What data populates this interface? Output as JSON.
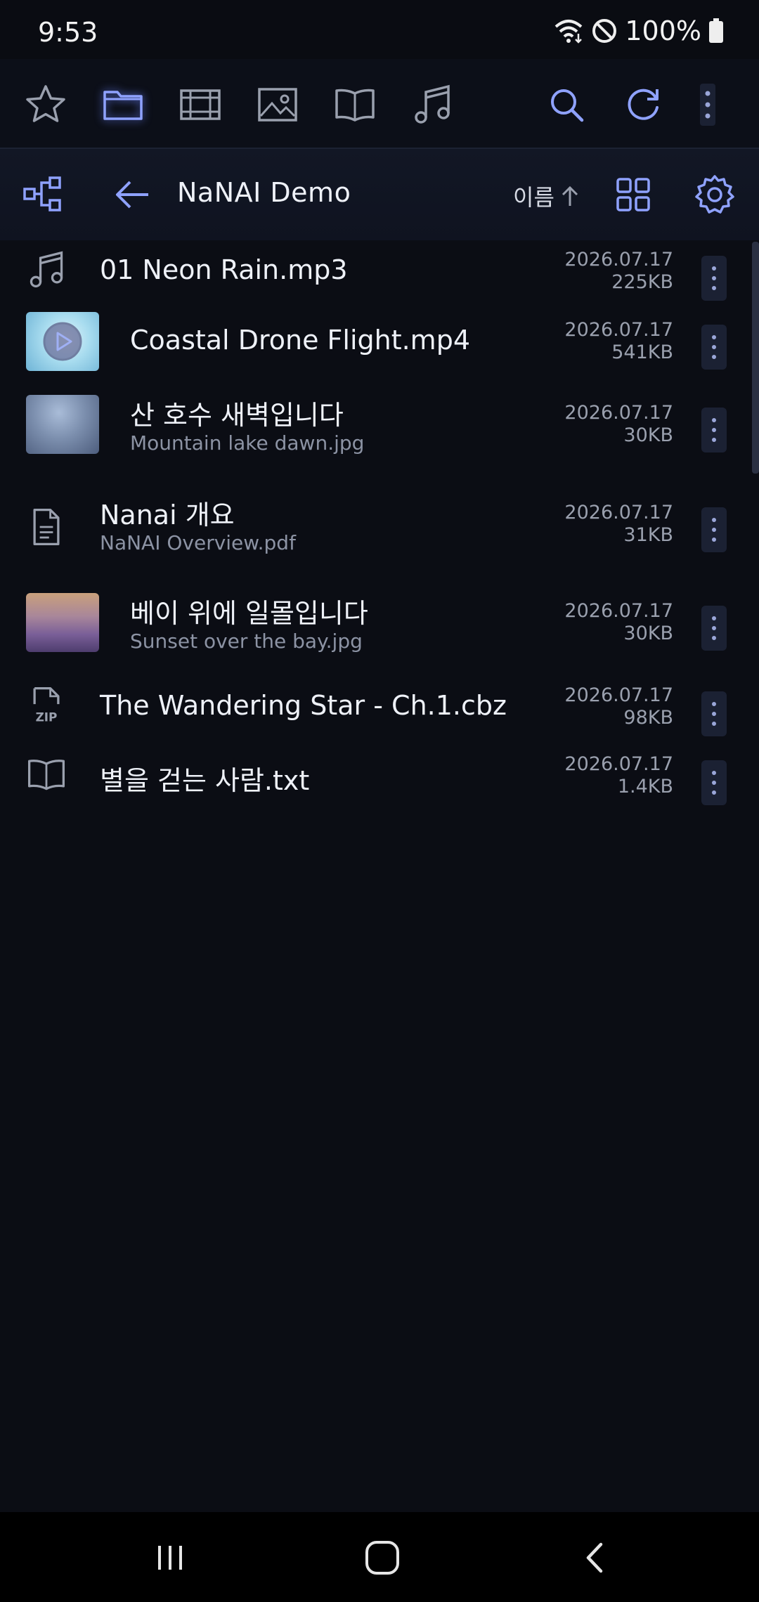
{
  "status_bar": {
    "time": "9:53",
    "battery_text": "100%"
  },
  "toolbar": {
    "icons": [
      "star-icon",
      "folder-icon",
      "film-icon",
      "image-icon",
      "book-icon",
      "music-icon",
      "search-icon",
      "refresh-icon",
      "more-icon"
    ],
    "active": "folder-icon",
    "accent_color": "#8fa2ff"
  },
  "header": {
    "title": "NaNAI Demo",
    "sort_label": "이름"
  },
  "files": [
    {
      "name": "01 Neon Rain.mp3",
      "subtitle": "",
      "date": "2026.07.17",
      "size": "225KB",
      "icon": "music-icon"
    },
    {
      "name": "Coastal Drone Flight.mp4",
      "subtitle": "",
      "date": "2026.07.17",
      "size": "541KB",
      "icon": "video-thumbnail"
    },
    {
      "name": "산 호수 새벽입니다",
      "subtitle": "Mountain lake dawn.jpg",
      "date": "2026.07.17",
      "size": "30KB",
      "icon": "image-thumbnail"
    },
    {
      "name": "Nanai 개요",
      "subtitle": "NaNAI Overview.pdf",
      "date": "2026.07.17",
      "size": "31KB",
      "icon": "document-icon"
    },
    {
      "name": "베이 위에 일몰입니다",
      "subtitle": "Sunset over the bay.jpg",
      "date": "2026.07.17",
      "size": "30KB",
      "icon": "image-thumbnail"
    },
    {
      "name": "The Wandering Star - Ch.1.cbz",
      "subtitle": "",
      "date": "2026.07.17",
      "size": "98KB",
      "icon": "zip-icon"
    },
    {
      "name": "별을 걷는 사람.txt",
      "subtitle": "",
      "date": "2026.07.17",
      "size": "1.4KB",
      "icon": "book-icon"
    }
  ]
}
